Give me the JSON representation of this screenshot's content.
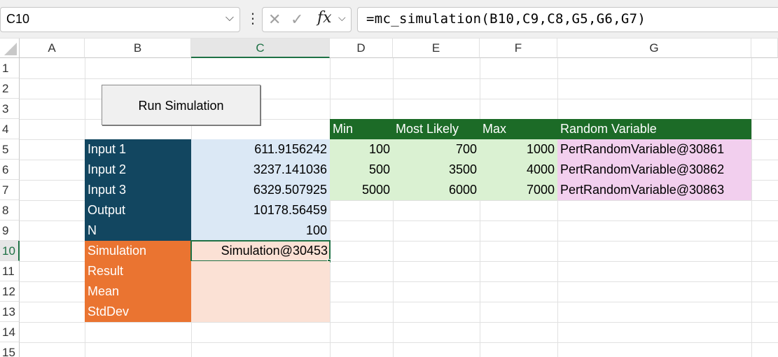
{
  "formula_bar": {
    "name_box": "C10",
    "formula": "=mc_simulation(B10,C9,C8,G5,G6,G7)"
  },
  "columns": [
    "A",
    "B",
    "C",
    "D",
    "E",
    "F",
    "G"
  ],
  "rows": [
    "1",
    "2",
    "3",
    "4",
    "5",
    "6",
    "7",
    "8",
    "9",
    "10",
    "11",
    "12",
    "13",
    "14",
    "15"
  ],
  "button": {
    "label": "Run Simulation"
  },
  "table_headers": {
    "min": "Min",
    "most_likely": "Most Likely",
    "max": "Max",
    "random_variable": "Random Variable"
  },
  "labels": {
    "input1": "Input 1",
    "input2": "Input 2",
    "input3": "Input 3",
    "output": "Output",
    "n": "N",
    "simulation": "Simulation",
    "result": "Result",
    "mean": "Mean",
    "stddev": "StdDev"
  },
  "values": {
    "input1": "611.9156242",
    "input2": "3237.141036",
    "input3": "6329.507925",
    "output": "10178.56459",
    "n": "100",
    "simulation": "Simulation@30453"
  },
  "distributions": [
    {
      "min": "100",
      "most_likely": "700",
      "max": "1000",
      "random_variable": "PertRandomVariable@30861"
    },
    {
      "min": "500",
      "most_likely": "3500",
      "max": "4000",
      "random_variable": "PertRandomVariable@30862"
    },
    {
      "min": "5000",
      "most_likely": "6000",
      "max": "7000",
      "random_variable": "PertRandomVariable@30863"
    }
  ]
}
